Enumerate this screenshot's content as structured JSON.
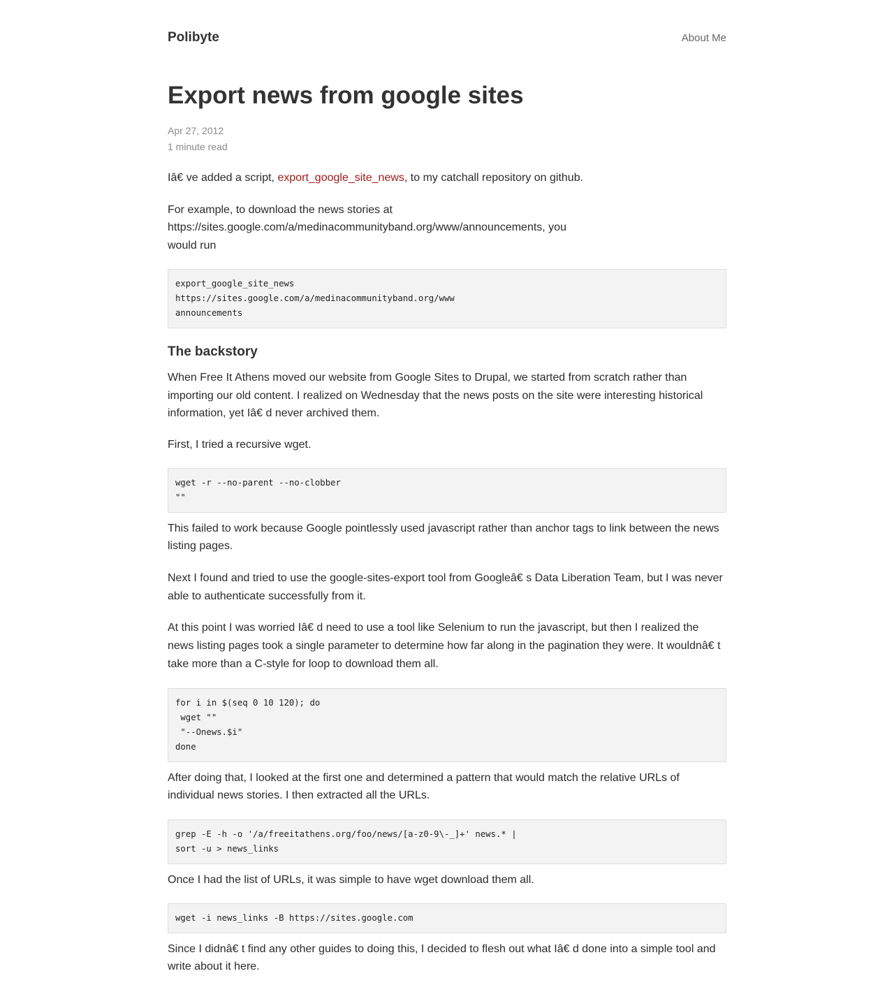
{
  "header": {
    "site_title": "Polibyte",
    "nav_about": "About Me"
  },
  "post": {
    "title": "Export news from google sites",
    "date": "Apr 27, 2012",
    "read_time": "1 minute read",
    "p1_before": "Iâ€   ve added a script, ",
    "p1_link": "export_google_site_news",
    "p1_after": ", to my catchall repository on github.",
    "p2_line1": "For example, to download the news stories at",
    "p2_line2": "https://sites.google.com/a/medinacommunityband.org/www/announcements, you",
    "p2_line3": "would run",
    "code1": "export_google_site_news\nhttps://sites.google.com/a/medinacommunityband.org/www\nannouncements",
    "backstory_heading": "The backstory",
    "p3": "When Free It Athens moved our website from Google Sites to Drupal, we started from scratch rather than importing our old content. I realized on Wednesday that the news posts on the site were interesting historical information, yet Iâ€   d never archived them.",
    "p4": "First, I tried a recursive wget.",
    "code2": "wget -r --no-parent --no-clobber\n\"\"",
    "p5": "This failed to work because Google pointlessly used javascript rather than anchor tags to link between the news listing pages.",
    "p6": "Next I found and tried to use the google-sites-export tool from Googleâ€   s Data Liberation Team, but I was never able to authenticate successfully from it.",
    "p7": "At this point I was worried Iâ€   d need to use a tool like Selenium to run the javascript, but then I realized the news listing pages took a single parameter to determine how far along in the pagination they were. It wouldnâ€   t take more than a C-style for loop to download them all.",
    "code3": "for i in $(seq 0 10 120); do\n wget \"\"\n \"--Onews.$i\"\ndone",
    "p8": "After doing that, I looked at the first one and determined a pattern that would match the relative URLs of individual news stories. I then extracted all the URLs.",
    "code4": "grep -E -h -o '/a/freeitathens.org/foo/news/[a-z0-9\\-_]+' news.* |\nsort -u > news_links",
    "p9": "Once I had the list of URLs, it was simple to have wget download them all.",
    "code5": "wget -i news_links -B https://sites.google.com",
    "p10": "Since I didnâ€   t find any other guides to doing this, I decided to flesh out what Iâ€   d done into a simple tool and write about it here."
  }
}
